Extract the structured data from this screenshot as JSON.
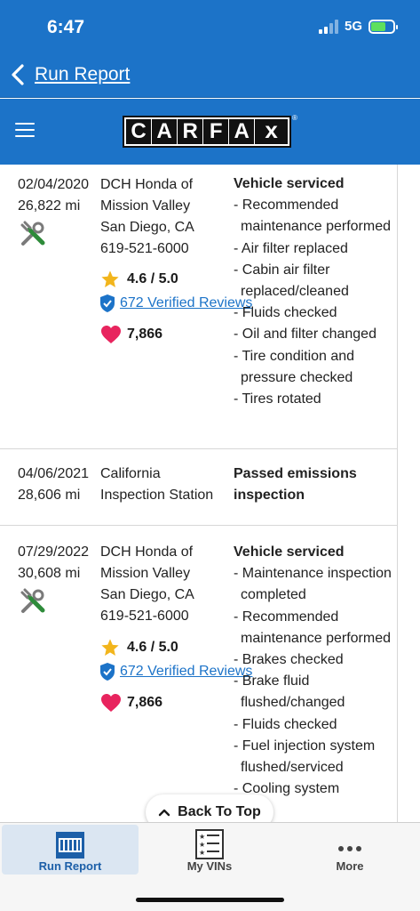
{
  "status_bar": {
    "time": "6:47",
    "network": "5G"
  },
  "nav": {
    "title": "Run Report"
  },
  "brand": {
    "logo_letters": [
      "C",
      "A",
      "R",
      "F",
      "A"
    ],
    "logo_x": "x",
    "reg": "®"
  },
  "records": [
    {
      "date": "02/04/2020",
      "mileage": "26,822 mi",
      "source_lines": [
        "DCH Honda of",
        "Mission Valley",
        "San Diego, CA",
        "619-521-6000"
      ],
      "rating": "4.6 / 5.0",
      "reviews": "672 Verified Reviews",
      "favorites": "7,866",
      "heading": "Vehicle serviced",
      "items": [
        "- Recommended maintenance performed",
        "- Air filter replaced",
        "- Cabin air filter replaced/cleaned",
        "- Fluids checked",
        "- Oil and filter changed",
        "- Tire condition and pressure checked",
        "- Tires rotated"
      ]
    },
    {
      "date": "04/06/2021",
      "mileage": "28,606 mi",
      "source_lines": [
        "California",
        "Inspection Station"
      ],
      "heading_lines": [
        "Passed emissions",
        "inspection"
      ]
    },
    {
      "date": "07/29/2022",
      "mileage": "30,608 mi",
      "source_lines": [
        "DCH Honda of",
        "Mission Valley",
        "San Diego, CA",
        "619-521-6000"
      ],
      "rating": "4.6 / 5.0",
      "reviews": "672 Verified Reviews",
      "favorites": "7,866",
      "heading": "Vehicle serviced",
      "items": [
        "- Maintenance inspection completed",
        "- Recommended maintenance performed",
        "- Brakes checked",
        "- Brake fluid flushed/changed",
        "- Fluids checked",
        "- Fuel injection system flushed/serviced",
        "- Cooling system"
      ]
    }
  ],
  "back_to_top": "Back To Top",
  "tabs": [
    {
      "label": "Run Report",
      "icon": "run-report-icon",
      "active": true
    },
    {
      "label": "My VINs",
      "icon": "vin-list-icon",
      "active": false
    },
    {
      "label": "More",
      "icon": "more-dots-icon",
      "active": false
    }
  ],
  "colors": {
    "brand_blue": "#1c73c8",
    "tool_green": "#2e8b3a",
    "star": "#f2b51c",
    "heart": "#e8245e",
    "link": "#1c73c8"
  }
}
